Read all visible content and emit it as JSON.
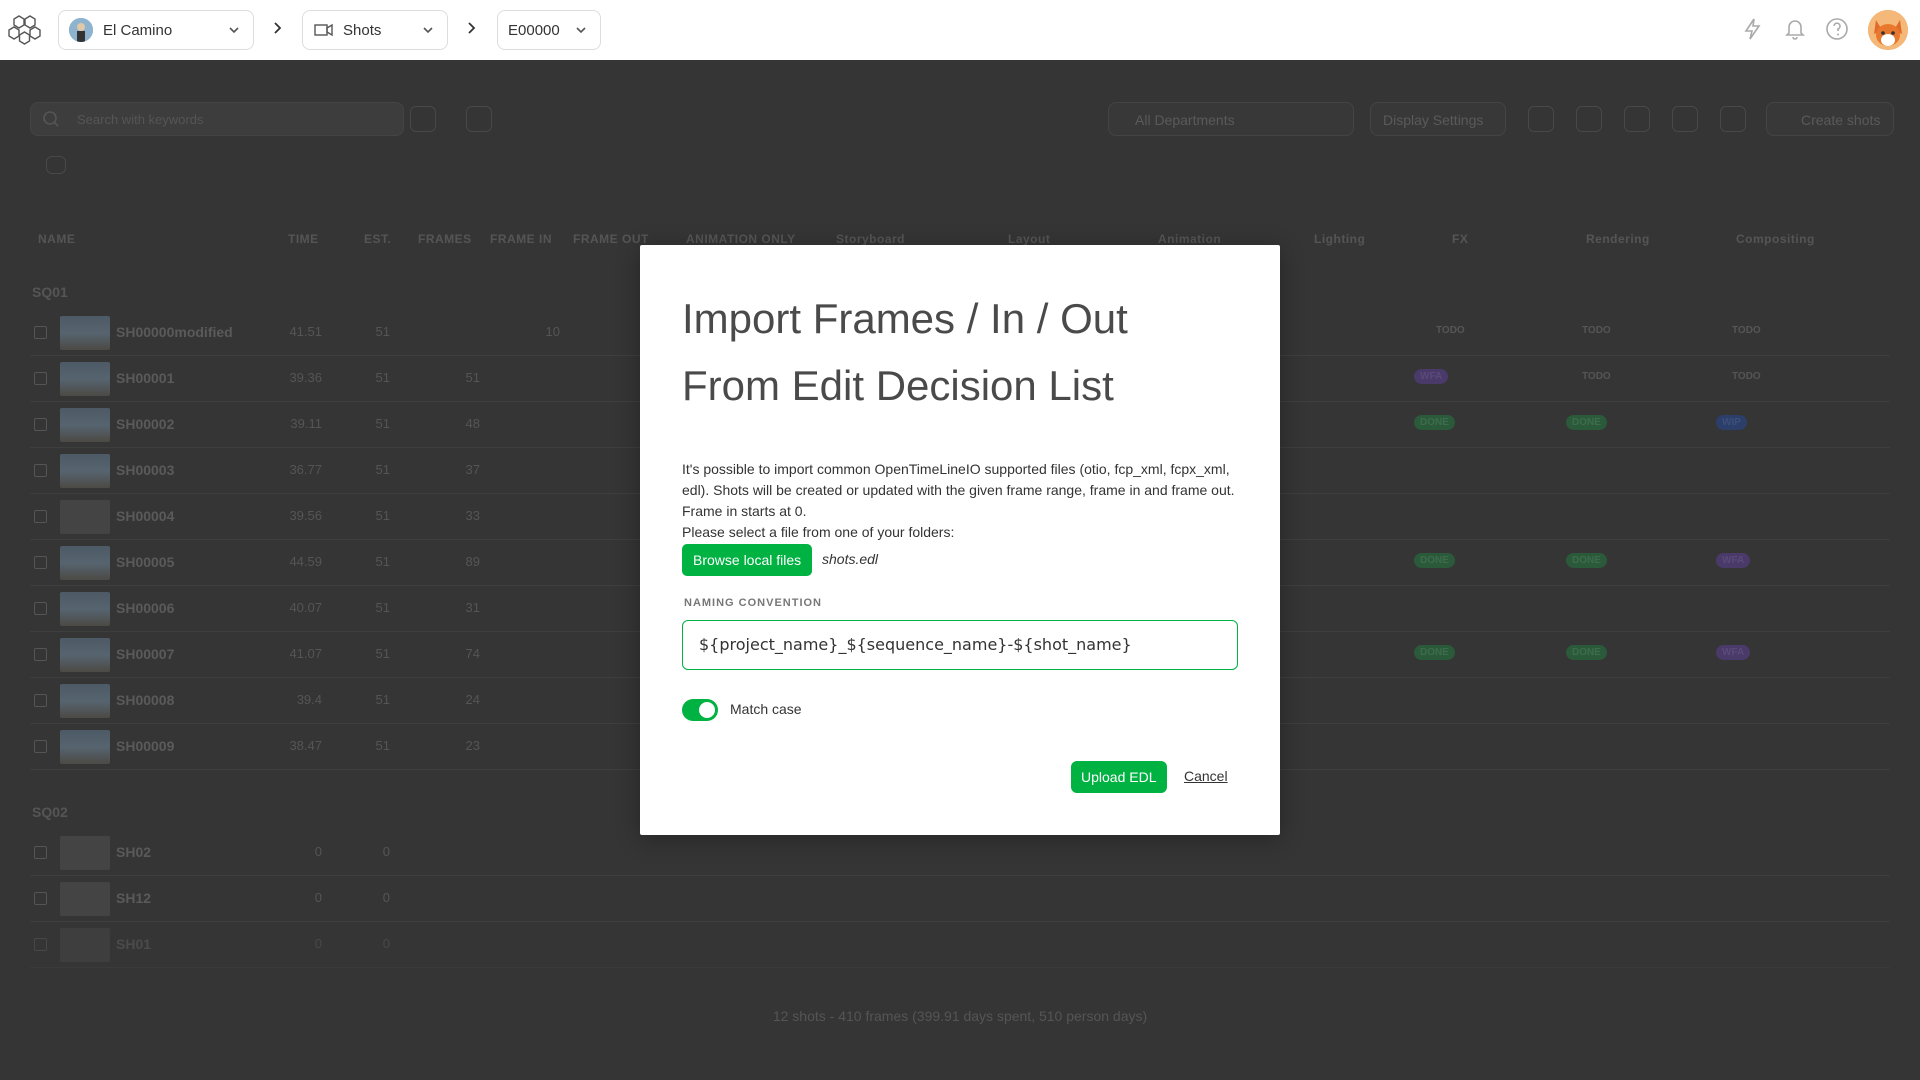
{
  "topbar": {
    "project": "El Camino",
    "section": "Shots",
    "episode": "E00000"
  },
  "toolbar": {
    "search_placeholder": "Search with keywords",
    "departments": "All Departments",
    "display_settings": "Display Settings",
    "create_shots": "Create shots"
  },
  "table": {
    "headers": [
      "NAME",
      "TIME",
      "EST.",
      "FRAMES",
      "FRAME IN",
      "FRAME OUT",
      "ANIMATION ONLY",
      "Storyboard",
      "Layout",
      "Animation",
      "Lighting",
      "FX",
      "Rendering",
      "Compositing"
    ],
    "sequences": [
      {
        "name": "SQ01",
        "shots": [
          {
            "name": "SH00000modified",
            "time": "41.51",
            "est": "51",
            "frames": "",
            "frame_in": "10"
          },
          {
            "name": "SH00001",
            "time": "39.36",
            "est": "51",
            "frames": "51",
            "frame_in": ""
          },
          {
            "name": "SH00002",
            "time": "39.11",
            "est": "51",
            "frames": "48",
            "frame_in": ""
          },
          {
            "name": "SH00003",
            "time": "36.77",
            "est": "51",
            "frames": "37",
            "frame_in": ""
          },
          {
            "name": "SH00004",
            "time": "39.56",
            "est": "51",
            "frames": "33",
            "frame_in": ""
          },
          {
            "name": "SH00005",
            "time": "44.59",
            "est": "51",
            "frames": "89",
            "frame_in": ""
          },
          {
            "name": "SH00006",
            "time": "40.07",
            "est": "51",
            "frames": "31",
            "frame_in": ""
          },
          {
            "name": "SH00007",
            "time": "41.07",
            "est": "51",
            "frames": "74",
            "frame_in": ""
          },
          {
            "name": "SH00008",
            "time": "39.4",
            "est": "51",
            "frames": "24",
            "frame_in": ""
          },
          {
            "name": "SH00009",
            "time": "38.47",
            "est": "51",
            "frames": "23",
            "frame_in": ""
          }
        ]
      },
      {
        "name": "SQ02",
        "shots": [
          {
            "name": "SH02",
            "time": "0",
            "est": "0",
            "frames": "",
            "frame_in": ""
          },
          {
            "name": "SH12",
            "time": "0",
            "est": "0",
            "frames": "",
            "frame_in": ""
          },
          {
            "name": "SH01",
            "time": "0",
            "est": "0",
            "frames": "",
            "frame_in": ""
          }
        ]
      }
    ],
    "footer": "12 shots - 410 frames (399.91 days spent, 510 person days)"
  },
  "status": {
    "todo": "TODO",
    "done": "DONE",
    "wfa": "WFA",
    "wip": "WIP"
  },
  "modal": {
    "title_line1": "Import Frames / In / Out",
    "title_line2": "From Edit Decision List",
    "description": "It's possible to import common OpenTimeLineIO supported files (otio, fcp_xml, fcpx_xml, edl). Shots will be created or updated with the given frame range, frame in and frame out. Frame in starts at 0.",
    "select_prompt": "Please select a file from one of your folders:",
    "browse_label": "Browse local files",
    "file_name": "shots.edl",
    "naming_label": "NAMING CONVENTION",
    "naming_value": "${project_name}_${sequence_name}-${shot_name}",
    "match_case_label": "Match case",
    "match_case_on": true,
    "upload_label": "Upload EDL",
    "cancel_label": "Cancel"
  },
  "colors": {
    "accent": "#00b242"
  }
}
